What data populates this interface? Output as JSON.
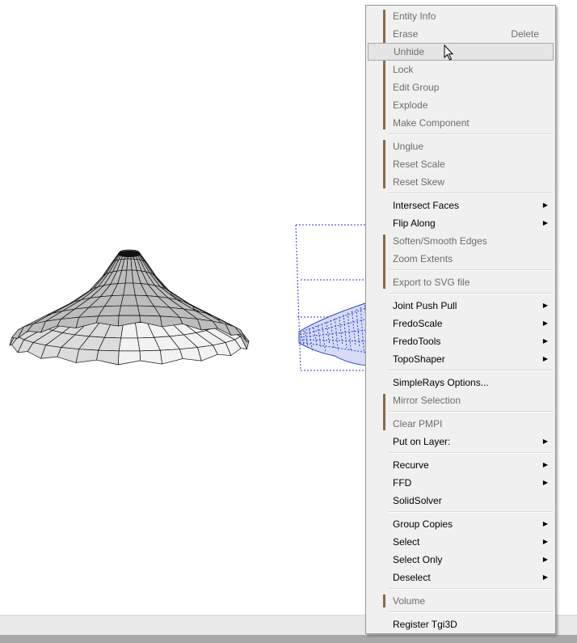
{
  "colors": {
    "menu_background": "#f0f0f0",
    "disabled_text": "#6d6d6d",
    "selection_box": "#2b3cc9",
    "gutter_bar": "#8a6a45"
  },
  "context_menu": {
    "items": [
      {
        "label": "Entity Info",
        "disabled": true
      },
      {
        "label": "Erase",
        "shortcut": "Delete",
        "disabled": true
      },
      {
        "label": "Unhide",
        "disabled": true,
        "highlighted": true
      },
      {
        "label": "Lock",
        "disabled": true
      },
      {
        "label": "Edit Group",
        "disabled": true
      },
      {
        "label": "Explode",
        "disabled": true
      },
      {
        "label": "Make Component",
        "disabled": true
      },
      {
        "label": "Unglue",
        "disabled": true
      },
      {
        "label": "Reset Scale",
        "disabled": true
      },
      {
        "label": "Reset Skew",
        "disabled": true
      },
      {
        "label": "Intersect Faces",
        "submenu": true
      },
      {
        "label": "Flip Along",
        "submenu": true
      },
      {
        "label": "Soften/Smooth Edges",
        "disabled": true
      },
      {
        "label": "Zoom Extents",
        "disabled": true
      },
      {
        "label": "Export to SVG file",
        "disabled": true
      },
      {
        "label": "Joint Push Pull",
        "submenu": true
      },
      {
        "label": "FredoScale",
        "submenu": true
      },
      {
        "label": "FredoTools",
        "submenu": true
      },
      {
        "label": "TopoShaper",
        "submenu": true
      },
      {
        "label": "SimpleRays Options..."
      },
      {
        "label": "Mirror Selection",
        "disabled": true
      },
      {
        "label": "Clear PMPI",
        "disabled": true
      },
      {
        "label": "Put on Layer:",
        "submenu": true
      },
      {
        "label": "Recurve",
        "submenu": true
      },
      {
        "label": "FFD",
        "submenu": true
      },
      {
        "label": "SolidSolver"
      },
      {
        "label": "Group Copies",
        "submenu": true
      },
      {
        "label": "Select",
        "submenu": true
      },
      {
        "label": "Select Only",
        "submenu": true
      },
      {
        "label": "Deselect",
        "submenu": true
      },
      {
        "label": "Volume",
        "disabled": true
      },
      {
        "label": "Register Tgi3D"
      }
    ]
  }
}
